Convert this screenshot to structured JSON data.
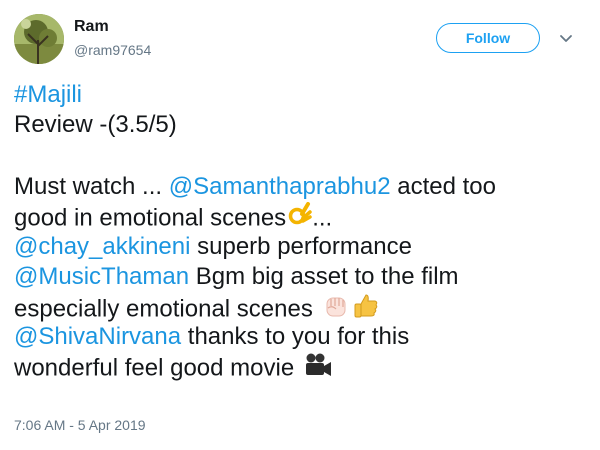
{
  "user": {
    "name": "Ram",
    "handle": "@ram97654",
    "follow_label": "Follow"
  },
  "tweet": {
    "hashtag": "#Majili",
    "review_line": "Review -(3.5/5)",
    "line1_text": "Must watch ... ",
    "mention1": "@Samanthaprabhu2",
    "line1_tail": " acted too",
    "line2_text": "good in emotional scenes",
    "line2_tail": "...",
    "mention2": "@chay_akkineni",
    "line3_tail": "  superb performance",
    "mention3": "@MusicThaman",
    "line4_tail": " Bgm big asset to the film",
    "line5_text": "especially emotional scenes ",
    "mention4": "@ShivaNirvana",
    "line6_tail": " thanks to you for this",
    "line7_text": "wonderful feel good movie "
  },
  "timestamp": "7:06 AM - 5 Apr 2019",
  "icons": [
    "avatar",
    "chevron-down-icon",
    "ok-hand-icon",
    "raised-fist-icon",
    "thumbs-up-icon",
    "movie-camera-icon"
  ],
  "colors": {
    "link": "#1b95e0",
    "accent": "#1da1f2",
    "muted": "#657786",
    "text": "#14171a"
  }
}
